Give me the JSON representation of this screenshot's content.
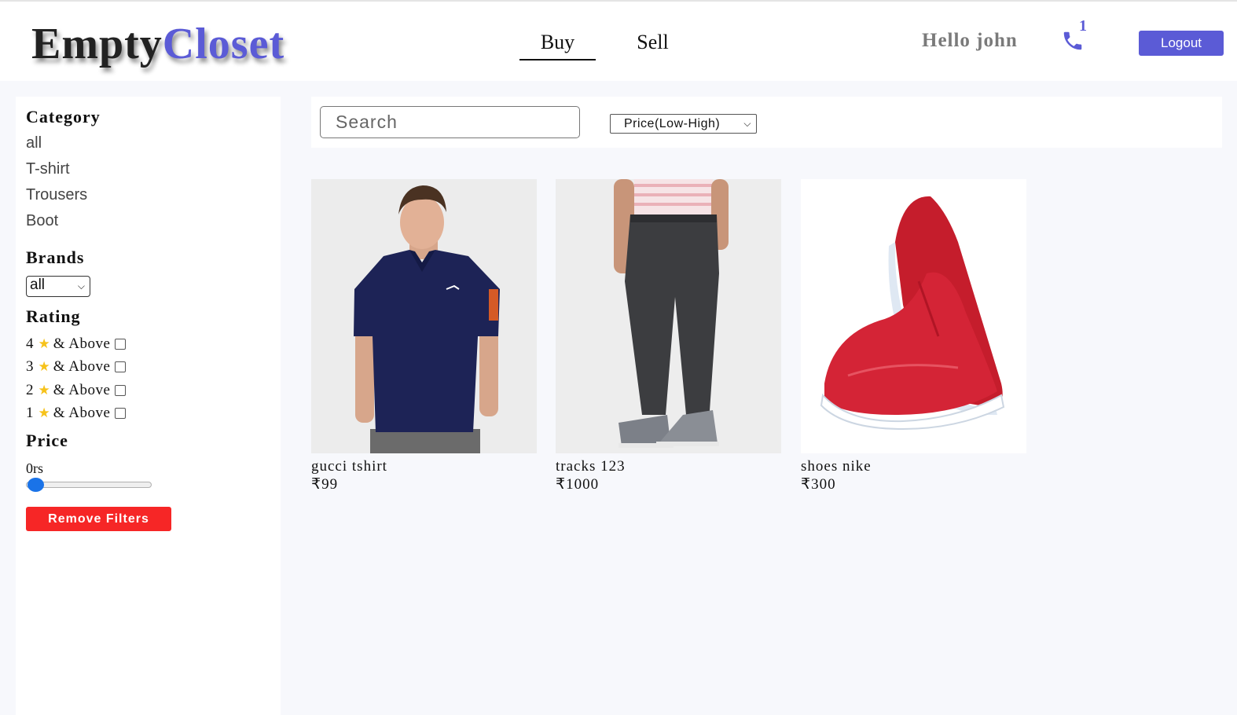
{
  "header": {
    "logo_part1": "Empty",
    "logo_part2": "Closet",
    "nav": [
      {
        "label": "Buy",
        "active": true
      },
      {
        "label": "Sell",
        "active": false
      }
    ],
    "greeting": "Hello john",
    "phone_icon": "phone-icon",
    "notification_count": "1",
    "logout_label": "Logout"
  },
  "sidebar": {
    "category_heading": "Category",
    "categories": [
      "all",
      "T-shirt",
      "Trousers",
      "Boot"
    ],
    "brands_heading": "Brands",
    "brand_selected": "all",
    "rating_heading": "Rating",
    "ratings": [
      {
        "value": "4",
        "label": "& Above"
      },
      {
        "value": "3",
        "label": "& Above"
      },
      {
        "value": "2",
        "label": "& Above"
      },
      {
        "value": "1",
        "label": "& Above"
      }
    ],
    "price_heading": "Price",
    "price_value": "0rs",
    "price_slider_fraction": 0,
    "remove_filters_label": "Remove Filters"
  },
  "toolbar": {
    "search_placeholder": "Search",
    "sort_selected": "Price(Low-High)"
  },
  "products": [
    {
      "name": "gucci tshirt",
      "price": "₹99",
      "image": "navy-polo-shirt"
    },
    {
      "name": "tracks 123",
      "price": "₹1000",
      "image": "grey-track-pants"
    },
    {
      "name": "shoes nike",
      "price": "₹300",
      "image": "red-sneakers"
    }
  ],
  "colors": {
    "accent": "#5b5bd6",
    "danger": "#f62626",
    "star": "#f6c21a",
    "background": "#f7f8fc"
  }
}
